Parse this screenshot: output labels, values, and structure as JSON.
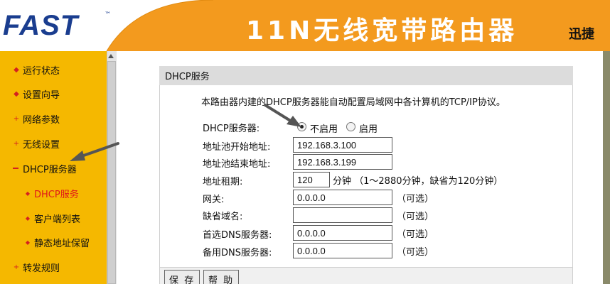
{
  "header": {
    "logo": "FAST",
    "logo_mark": "™",
    "product_title": "11N无线宽带路由器",
    "brand": "迅捷"
  },
  "colors": {
    "header_orange": "#f39a1e",
    "sidebar_yellow": "#f5b800",
    "logo_blue": "#1a3d8f",
    "active_red": "#e01818"
  },
  "sidebar": {
    "items": [
      {
        "label": "运行状态"
      },
      {
        "label": "设置向导"
      },
      {
        "label": "网络参数"
      },
      {
        "label": "无线设置"
      },
      {
        "label": "DHCP服务器"
      },
      {
        "label": "DHCP服务"
      },
      {
        "label": "客户端列表"
      },
      {
        "label": "静态地址保留"
      },
      {
        "label": "转发规则"
      }
    ]
  },
  "panel": {
    "title": "DHCP服务",
    "description": "本路由器内建的DHCP服务器能自动配置局域网中各计算机的TCP/IP协议。",
    "server_label": "DHCP服务器:",
    "radio_disable": "不启用",
    "radio_enable": "启用",
    "fields": {
      "start_label": "地址池开始地址:",
      "start_value": "192.168.3.100",
      "end_label": "地址池结束地址:",
      "end_value": "192.168.3.199",
      "lease_label": "地址租期:",
      "lease_value": "120",
      "lease_hint": "分钟 （1～2880分钟，缺省为120分钟）",
      "gateway_label": "网关:",
      "gateway_value": "0.0.0.0",
      "domain_label": "缺省域名:",
      "domain_value": "",
      "dns1_label": "首选DNS服务器:",
      "dns1_value": "0.0.0.0",
      "dns2_label": "备用DNS服务器:",
      "dns2_value": "0.0.0.0",
      "optional": "（可选）"
    },
    "buttons": {
      "save": "保 存",
      "help": "帮 助"
    }
  }
}
